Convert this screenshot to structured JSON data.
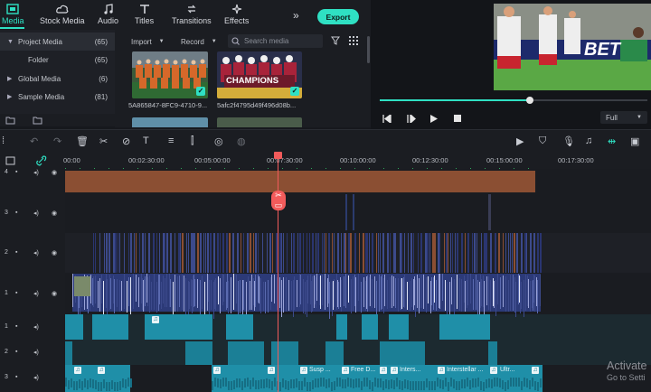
{
  "tabs": [
    {
      "label": "Media",
      "active": true,
      "icon": "media-icon"
    },
    {
      "label": "Stock Media",
      "active": false,
      "icon": "cloud-icon"
    },
    {
      "label": "Audio",
      "active": false,
      "icon": "music-icon"
    },
    {
      "label": "Titles",
      "active": false,
      "icon": "titles-icon"
    },
    {
      "label": "Transitions",
      "active": false,
      "icon": "transitions-icon"
    },
    {
      "label": "Effects",
      "active": false,
      "icon": "effects-icon"
    }
  ],
  "export_label": "Export",
  "sidebar": {
    "items": [
      {
        "label": "Project Media",
        "count": "(65)",
        "expanded": true,
        "active": true
      },
      {
        "label": "Folder",
        "count": "(65)",
        "child": true
      },
      {
        "label": "Global Media",
        "count": "(6)",
        "expanded": false
      },
      {
        "label": "Sample Media",
        "count": "(81)",
        "expanded": false
      }
    ]
  },
  "media_toolbar": {
    "import_label": "Import",
    "record_label": "Record",
    "search_placeholder": "Search media"
  },
  "media_items": [
    {
      "caption": "5A865847-8FC9-4710-9...",
      "selected": true
    },
    {
      "caption": "5afc2f4795d49f496d08b...",
      "selected": true,
      "overlay_text": "CHAMPIONS"
    }
  ],
  "preview": {
    "zoom_option": "Full",
    "progress": 0.56,
    "scene_text": "BET"
  },
  "ruler": {
    "ticks": [
      "00:00",
      "00:02:30:00",
      "00:05:00:00",
      "00:07:30:00",
      "00:10:00:00",
      "00:12:30:00",
      "00:15:00:00",
      "00:17:30:00"
    ]
  },
  "tracks": [
    {
      "number": "4"
    },
    {
      "number": "3"
    },
    {
      "number": "2"
    },
    {
      "number": "1"
    },
    {
      "number": "1"
    },
    {
      "number": "2"
    },
    {
      "number": "3"
    }
  ],
  "audio_clips": [
    "Susp ...",
    "Free D...",
    "Inters...",
    "Interstellar ...",
    "Ultr..."
  ],
  "watermark": {
    "line1": "Activate",
    "line2": "Go to Setti"
  },
  "colors": {
    "accent": "#2fe0c3",
    "playhead": "#f25b5b",
    "title_clip": "#8b4f33",
    "video_clip": "#3c4a8c",
    "audio_clip": "#1f8fa8"
  }
}
